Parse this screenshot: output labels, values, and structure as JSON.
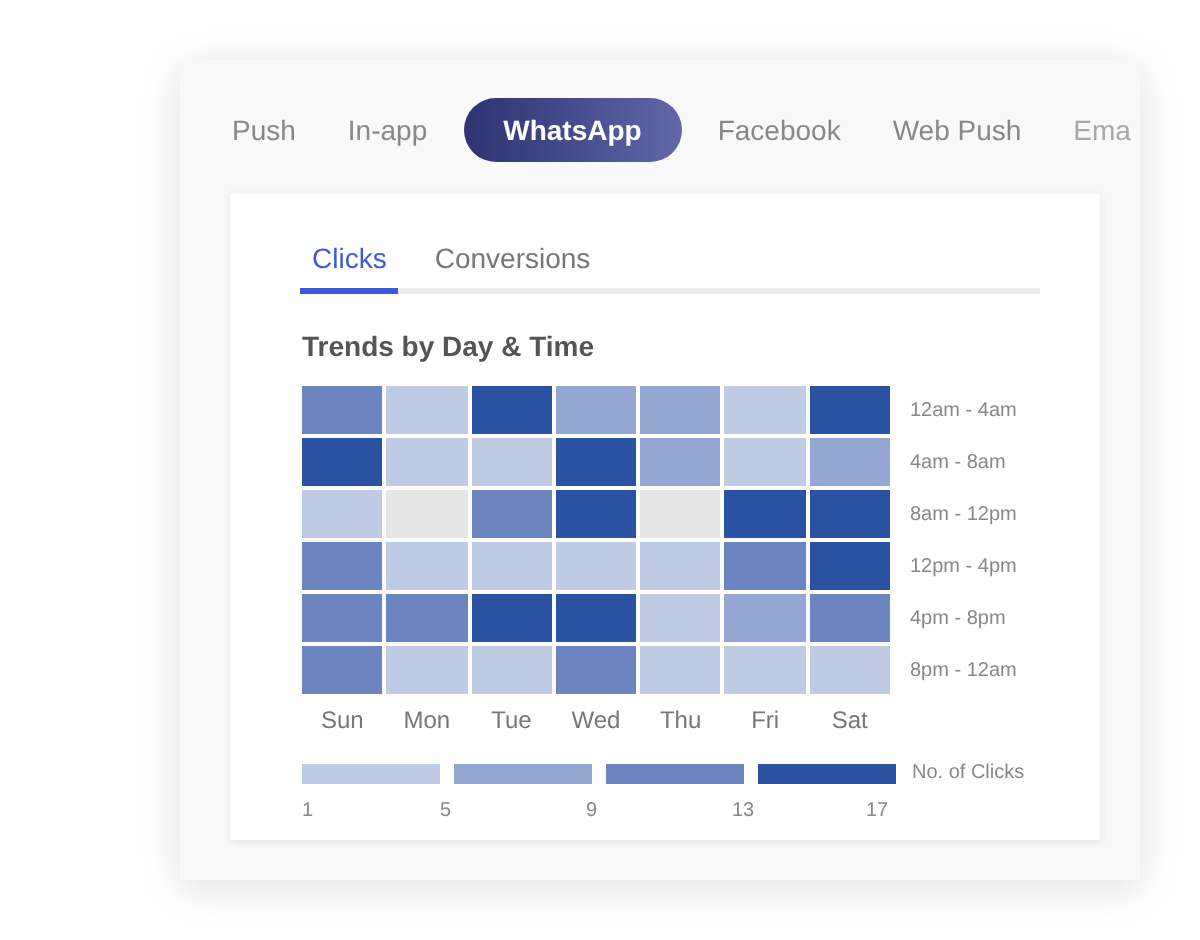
{
  "channel_tabs": [
    {
      "label": "Push",
      "selected": false
    },
    {
      "label": "In-app",
      "selected": false
    },
    {
      "label": "WhatsApp",
      "selected": true
    },
    {
      "label": "Facebook",
      "selected": false
    },
    {
      "label": "Web Push",
      "selected": false
    },
    {
      "label": "Ema",
      "selected": false
    }
  ],
  "metric_tabs": [
    {
      "label": "Clicks",
      "selected": true
    },
    {
      "label": "Conversions",
      "selected": false
    }
  ],
  "title": "Trends by Day & Time",
  "heatmap": {
    "rows": [
      {
        "label": "12am - 4am",
        "cells": [
          {
            "color": "#6c84c0"
          },
          {
            "color": "#c0cbe4"
          },
          {
            "color": "#2c52a4"
          },
          {
            "color": "#94a7d2"
          },
          {
            "color": "#94a7d2"
          },
          {
            "color": "#c0cbe4"
          },
          {
            "color": "#2c52a4"
          }
        ]
      },
      {
        "label": "4am - 8am",
        "cells": [
          {
            "color": "#2c52a4"
          },
          {
            "color": "#c0cbe4"
          },
          {
            "color": "#c0cbe4"
          },
          {
            "color": "#2c52a4"
          },
          {
            "color": "#94a7d2"
          },
          {
            "color": "#c0cbe4"
          },
          {
            "color": "#94a7d2"
          }
        ]
      },
      {
        "label": "8am - 12pm",
        "cells": [
          {
            "color": "#c0cbe4"
          },
          {
            "color": "#e6e6e6"
          },
          {
            "color": "#6c84c0"
          },
          {
            "color": "#2c52a4"
          },
          {
            "color": "#e6e6e6"
          },
          {
            "color": "#2c52a4"
          },
          {
            "color": "#2c52a4"
          }
        ]
      },
      {
        "label": "12pm - 4pm",
        "cells": [
          {
            "color": "#6c84c0"
          },
          {
            "color": "#c0cbe4"
          },
          {
            "color": "#c0cbe4"
          },
          {
            "color": "#c0cbe4"
          },
          {
            "color": "#c0cbe4"
          },
          {
            "color": "#6c84c0"
          },
          {
            "color": "#2c52a4"
          }
        ]
      },
      {
        "label": "4pm - 8pm",
        "cells": [
          {
            "color": "#6c84c0"
          },
          {
            "color": "#6c84c0"
          },
          {
            "color": "#2c52a4"
          },
          {
            "color": "#2c52a4"
          },
          {
            "color": "#c0cbe4"
          },
          {
            "color": "#94a7d2"
          },
          {
            "color": "#6c84c0"
          }
        ]
      },
      {
        "label": "8pm - 12am",
        "cells": [
          {
            "color": "#6c84c0"
          },
          {
            "color": "#c0cbe4"
          },
          {
            "color": "#c0cbe4"
          },
          {
            "color": "#6c84c0"
          },
          {
            "color": "#c0cbe4"
          },
          {
            "color": "#c0cbe4"
          },
          {
            "color": "#c0cbe4"
          }
        ]
      }
    ],
    "days": [
      "Sun",
      "Mon",
      "Tue",
      "Wed",
      "Thu",
      "Fri",
      "Sat"
    ]
  },
  "legend": {
    "segments": [
      {
        "color": "#c0cbe4"
      },
      {
        "color": "#94a7d2"
      },
      {
        "color": "#6c84c0"
      },
      {
        "color": "#2c52a4"
      }
    ],
    "label": "No. of Clicks",
    "ticks": [
      "1",
      "5",
      "9",
      "13",
      "17"
    ]
  }
}
